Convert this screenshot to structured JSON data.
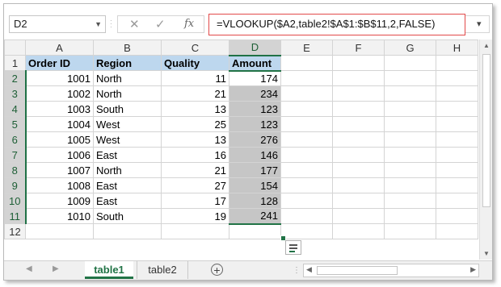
{
  "name_box": "D2",
  "name_box_dropdown_icon": "chevron-down-icon",
  "formula_buttons": {
    "cancel": "✕",
    "enter": "✓",
    "function": "fx"
  },
  "formula": "=VLOOKUP($A2,table2!$A$1:$B$11,2,FALSE)",
  "columns": [
    "A",
    "B",
    "C",
    "D",
    "E",
    "F",
    "G",
    "H"
  ],
  "row_numbers": [
    "1",
    "2",
    "3",
    "4",
    "5",
    "6",
    "7",
    "8",
    "9",
    "10",
    "11",
    "12"
  ],
  "headers": {
    "a": "Order ID",
    "b": "Region",
    "c": "Quality",
    "d": "Amount"
  },
  "rows": [
    {
      "a": "1001",
      "b": "North",
      "c": "11",
      "d": "174"
    },
    {
      "a": "1002",
      "b": "North",
      "c": "21",
      "d": "234"
    },
    {
      "a": "1003",
      "b": "South",
      "c": "13",
      "d": "123"
    },
    {
      "a": "1004",
      "b": "West",
      "c": "25",
      "d": "123"
    },
    {
      "a": "1005",
      "b": "West",
      "c": "13",
      "d": "276"
    },
    {
      "a": "1006",
      "b": "East",
      "c": "16",
      "d": "146"
    },
    {
      "a": "1007",
      "b": "North",
      "c": "21",
      "d": "177"
    },
    {
      "a": "1008",
      "b": "East",
      "c": "27",
      "d": "154"
    },
    {
      "a": "1009",
      "b": "East",
      "c": "17",
      "d": "128"
    },
    {
      "a": "1010",
      "b": "South",
      "c": "19",
      "d": "241"
    }
  ],
  "sheet_tabs": {
    "active": "table1",
    "other": "table2"
  },
  "add_sheet": "⊕",
  "colors": {
    "header_fill": "#bdd7ee",
    "selection_fill": "#c6c6c6",
    "excel_green": "#217346",
    "formula_border": "#e24a4a"
  }
}
